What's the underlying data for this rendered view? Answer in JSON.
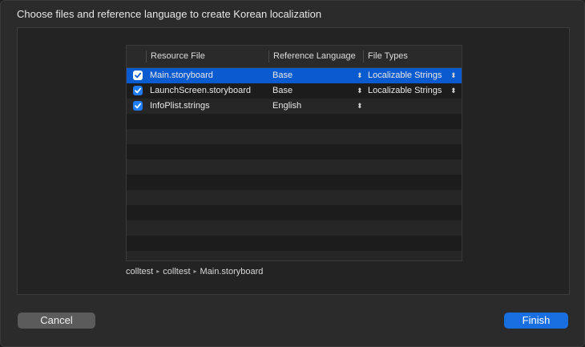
{
  "dialog": {
    "title": "Choose files and reference language to create Korean localization"
  },
  "table": {
    "columns": {
      "resource_file": "Resource File",
      "reference_language": "Reference Language",
      "file_types": "File Types"
    },
    "rows": [
      {
        "checked": true,
        "file": "Main.storyboard",
        "language": "Base",
        "file_type": "Localizable Strings",
        "selected": true
      },
      {
        "checked": true,
        "file": "LaunchScreen.storyboard",
        "language": "Base",
        "file_type": "Localizable Strings",
        "selected": false
      },
      {
        "checked": true,
        "file": "InfoPlist.strings",
        "language": "English",
        "file_type": "",
        "selected": false
      }
    ]
  },
  "path": {
    "segments": [
      "colltest",
      "colltest",
      "Main.storyboard"
    ],
    "separator": "▸"
  },
  "buttons": {
    "cancel": "Cancel",
    "finish": "Finish"
  },
  "colors": {
    "accent": "#1a6fe0",
    "selection": "#0a5bd0"
  }
}
